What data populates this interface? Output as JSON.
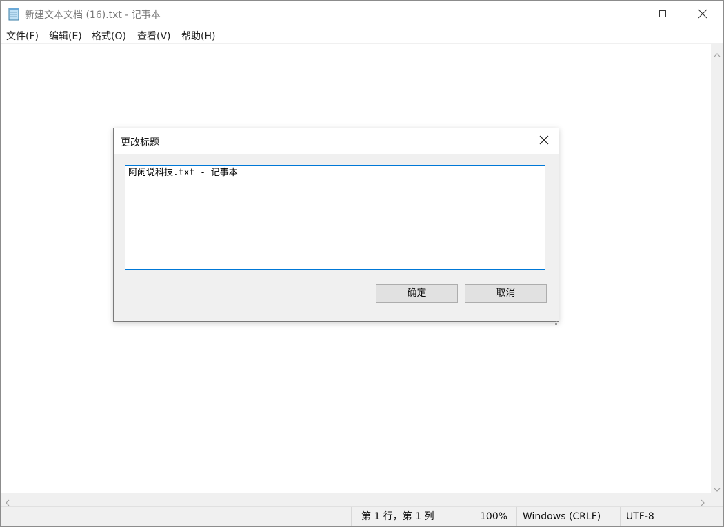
{
  "window": {
    "title": "新建文本文档 (16).txt - 记事本",
    "icon": "notepad-icon",
    "controls": [
      "minimize-icon",
      "maximize-icon",
      "close-icon"
    ]
  },
  "menu": {
    "items": [
      {
        "label": "文件(F)"
      },
      {
        "label": "编辑(E)"
      },
      {
        "label": "格式(O)"
      },
      {
        "label": "查看(V)"
      },
      {
        "label": "帮助(H)"
      }
    ]
  },
  "status": {
    "position": "第 1 行，第 1 列",
    "zoom": "100%",
    "line_ending": "Windows (CRLF)",
    "encoding": "UTF-8"
  },
  "dialog": {
    "title": "更改标题",
    "input_value": "阿闲说科技.txt - 记事本",
    "ok_label": "确定",
    "cancel_label": "取消"
  },
  "colors": {
    "accent": "#0078d7",
    "dialog_bg": "#f0f0f0",
    "button_bg": "#e1e1e1"
  }
}
